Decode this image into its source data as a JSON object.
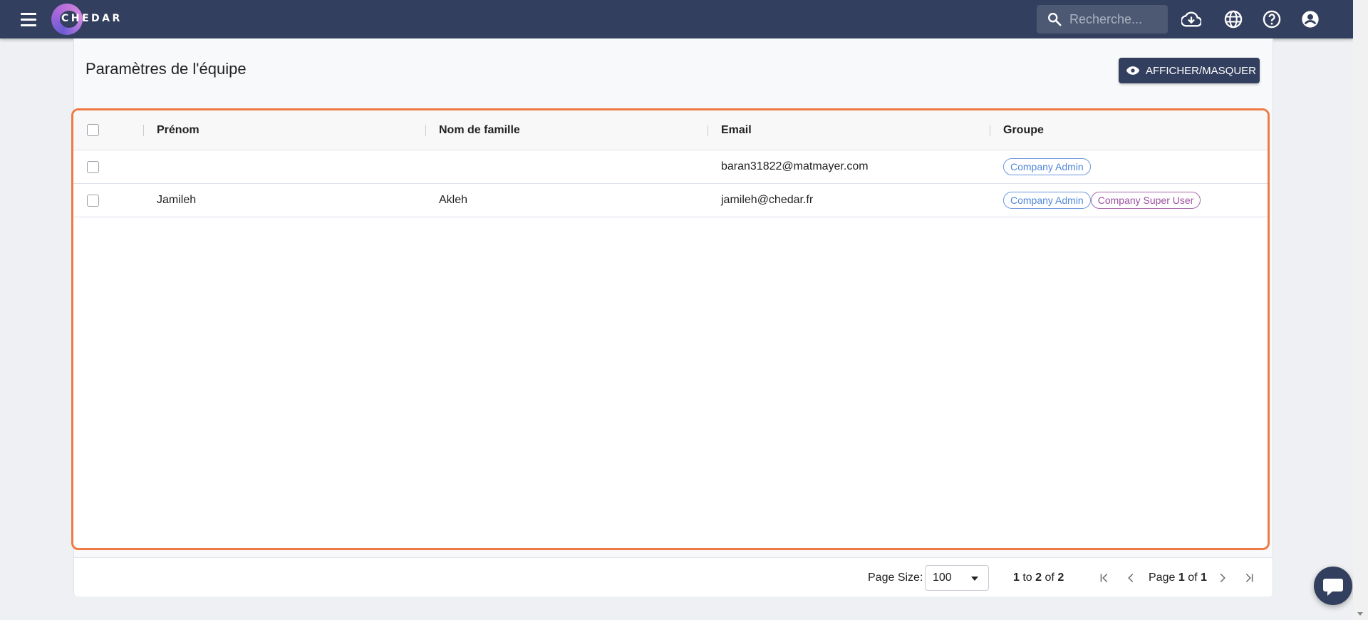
{
  "app": {
    "brand": "CHEDAR"
  },
  "topbar": {
    "search_placeholder": "Recherche...",
    "icons": [
      "menu-icon",
      "cloud-download-icon",
      "globe-icon",
      "help-icon",
      "account-icon"
    ]
  },
  "page": {
    "title": "Paramètres de l'équipe",
    "toggle_button": "AFFICHER/MASQUER"
  },
  "table": {
    "columns": [
      "Prénom",
      "Nom de famille",
      "Email",
      "Groupe"
    ],
    "rows": [
      {
        "first_name": "",
        "last_name": "",
        "email": "baran31822@matmayer.com",
        "groups": [
          "Company Admin"
        ]
      },
      {
        "first_name": "Jamileh",
        "last_name": "Akleh",
        "email": "jamileh@chedar.fr",
        "groups": [
          "Company Admin",
          "Company Super User"
        ]
      }
    ]
  },
  "pager": {
    "page_size_label": "Page Size:",
    "page_size_value": "100",
    "range_from": "1",
    "range_to_word": "to",
    "range_to": "2",
    "range_of_word": "of",
    "range_total": "2",
    "page_word": "Page",
    "page_current": "1",
    "page_of_word": "of",
    "page_total": "1"
  },
  "colors": {
    "topbar": "#333f5e",
    "accent_border": "#f07a43",
    "tag_admin": "#4f86d8",
    "tag_super": "#9b4f9e"
  }
}
